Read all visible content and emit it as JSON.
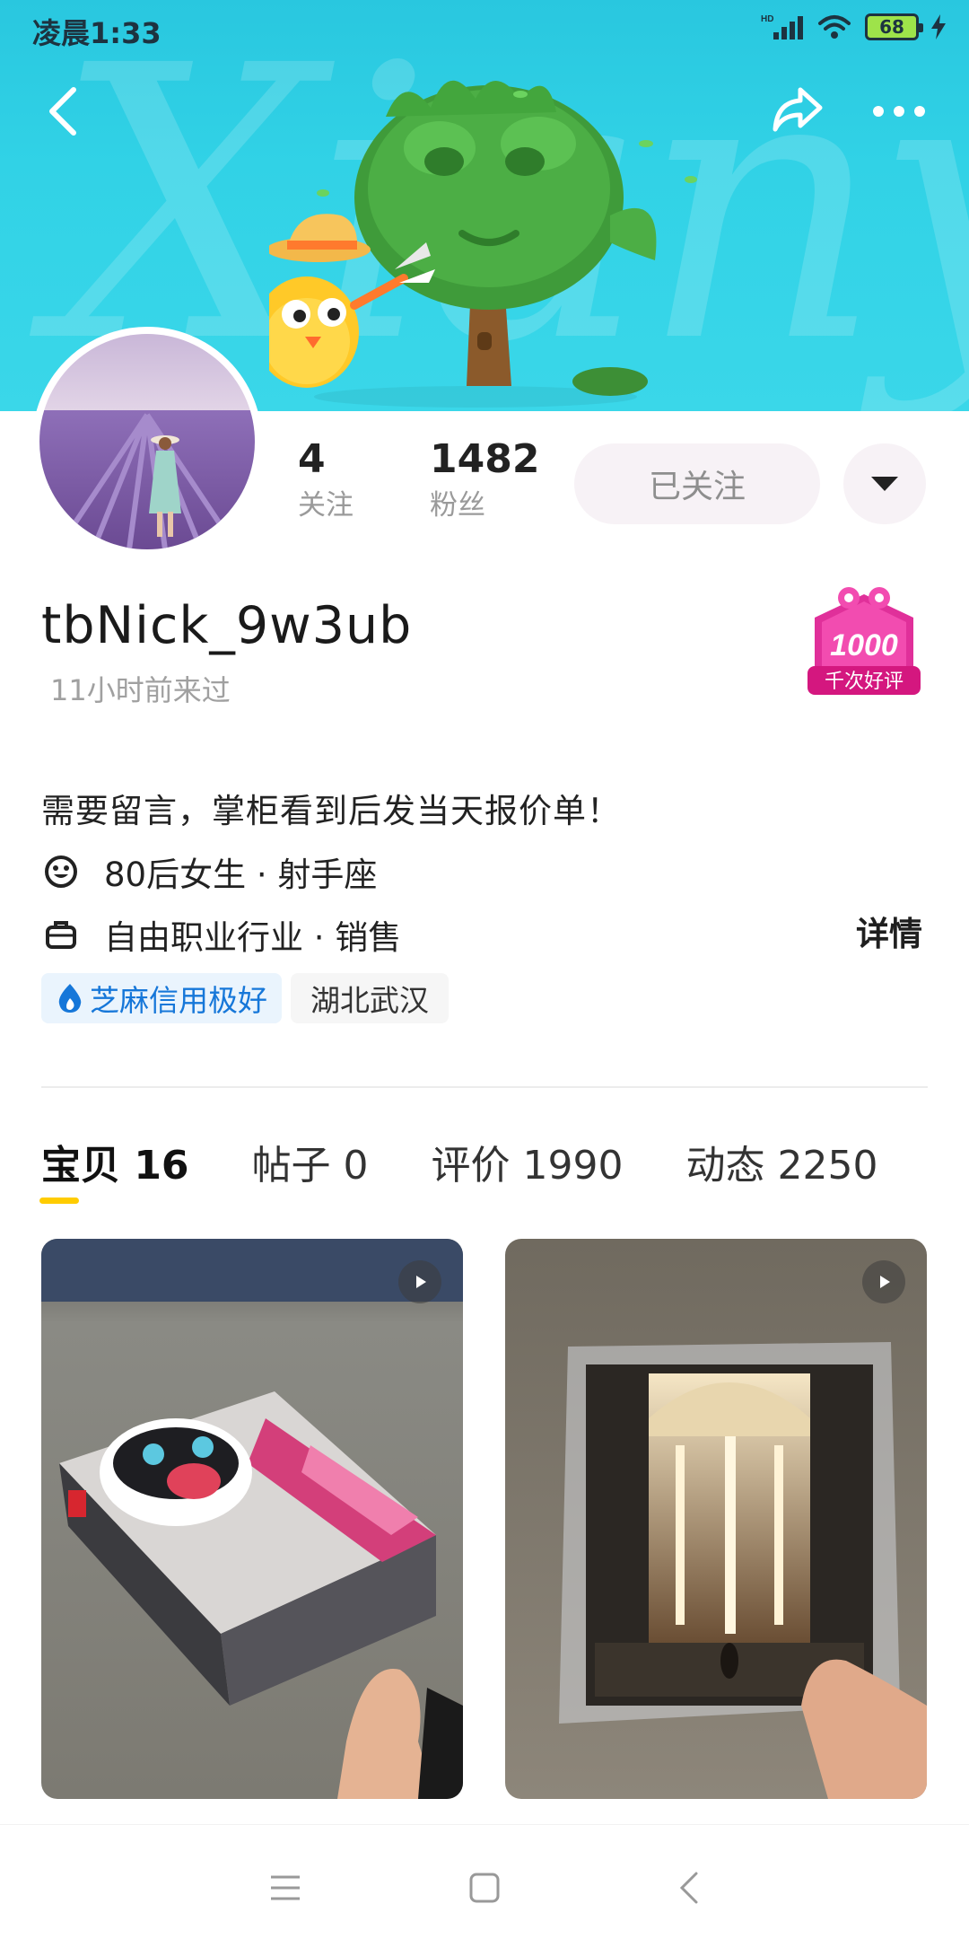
{
  "status_bar": {
    "time": "凌晨1:33",
    "battery": "68",
    "network": "HD"
  },
  "profile": {
    "following_count": "4",
    "following_label": "关注",
    "followers_count": "1482",
    "followers_label": "粉丝",
    "follow_button": "已关注",
    "username": "tbNick_9w3ub",
    "last_seen": "11小时前来过",
    "badge_number": "1000",
    "badge_text": "千次好评",
    "bio": "需要留言，掌柜看到后发当天报价单！",
    "info_personal": "80后女生 · 射手座",
    "info_occupation": "自由职业行业 · 销售",
    "detail_link": "详情",
    "tag_credit": "芝麻信用极好",
    "tag_location": "湖北武汉"
  },
  "banner": {
    "watermark": "Xianyu"
  },
  "tabs": [
    {
      "label": "宝贝 16",
      "active": true
    },
    {
      "label": "帖子 0",
      "active": false
    },
    {
      "label": "评价 1990",
      "active": false
    },
    {
      "label": "动态 2250",
      "active": false
    }
  ],
  "colors": {
    "banner": "#31d2e6",
    "tab_indicator": "#ffcc00",
    "credit_tag": "#1677d9",
    "follow_bg": "#f7f2f6",
    "badge": "#e0309a"
  },
  "icons": {
    "back": "chevron-left-icon",
    "share": "share-arrow-icon",
    "more": "ellipsis-icon",
    "dropdown": "caret-down-icon",
    "personal": "smiley-icon",
    "occupation": "briefcase-icon",
    "credit": "flame-drop-icon",
    "play": "play-icon",
    "nav_menu": "menu-icon",
    "nav_home": "square-icon",
    "nav_back": "chevron-left-icon"
  }
}
